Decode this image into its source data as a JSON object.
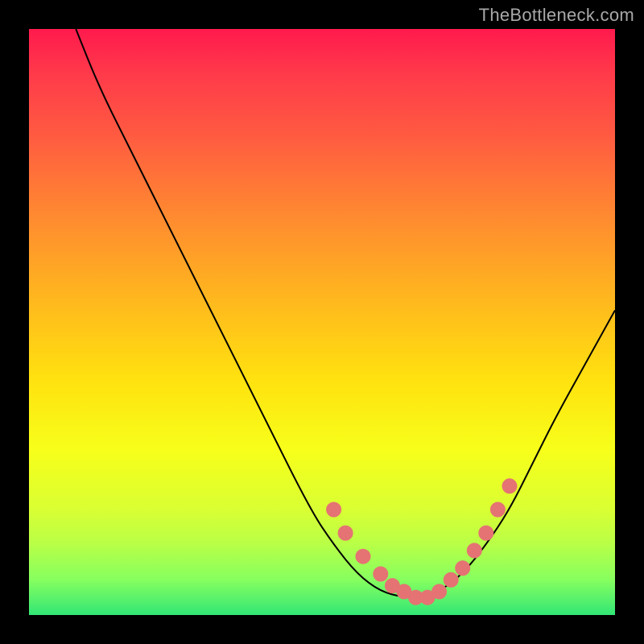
{
  "watermark": "TheBottleneck.com",
  "colors": {
    "bg": "#000000",
    "top": "#ff1a4d",
    "mid": "#ffe20f",
    "bottom": "#32e676",
    "line": "#000000",
    "marker": "#e57373"
  },
  "chart_data": {
    "type": "line",
    "title": "",
    "xlabel": "",
    "ylabel": "",
    "xlim": [
      0,
      100
    ],
    "ylim": [
      0,
      100
    ],
    "series": [
      {
        "name": "curve",
        "x": [
          8,
          12,
          18,
          25,
          32,
          40,
          48,
          52,
          56,
          60,
          64,
          67,
          70,
          74,
          78,
          82,
          86,
          90,
          95,
          100
        ],
        "y": [
          100,
          90,
          78,
          64,
          50,
          34,
          18,
          12,
          7,
          4,
          3,
          3,
          4,
          7,
          12,
          18,
          26,
          34,
          43,
          52
        ]
      }
    ],
    "markers": {
      "name": "highlight-points",
      "x": [
        52,
        54,
        57,
        60,
        62,
        64,
        66,
        68,
        70,
        72,
        74,
        76,
        78,
        80,
        82
      ],
      "y": [
        18,
        14,
        10,
        7,
        5,
        4,
        3,
        3,
        4,
        6,
        8,
        11,
        14,
        18,
        22
      ]
    }
  }
}
